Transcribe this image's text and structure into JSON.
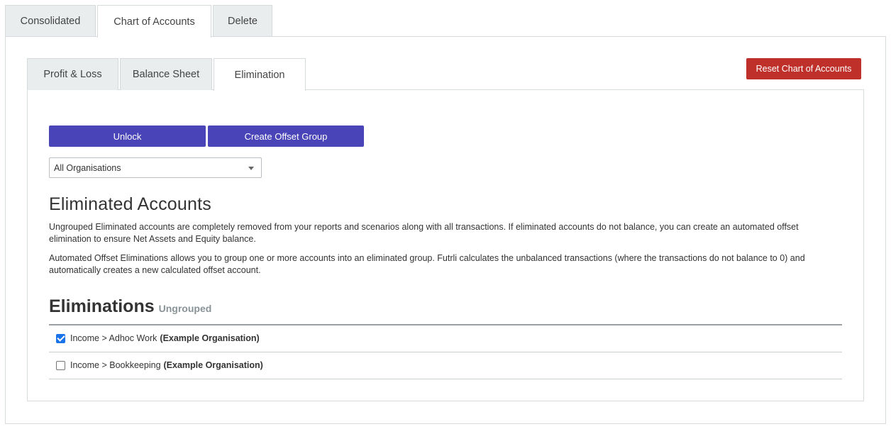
{
  "top_tabs": [
    {
      "label": "Consolidated",
      "active": false
    },
    {
      "label": "Chart of Accounts",
      "active": true
    },
    {
      "label": "Delete",
      "active": false
    }
  ],
  "inner_tabs": [
    {
      "label": "Profit & Loss",
      "active": false
    },
    {
      "label": "Balance Sheet",
      "active": false
    },
    {
      "label": "Elimination",
      "active": true
    }
  ],
  "actions": {
    "reset_label": "Reset Chart of Accounts",
    "unlock_label": "Unlock",
    "create_offset_label": "Create Offset Group"
  },
  "filter": {
    "selected": "All Organisations"
  },
  "eliminated_accounts": {
    "title": "Eliminated Accounts",
    "paragraph1": "Ungrouped Eliminated accounts are completely removed from your reports and scenarios along with all transactions. If eliminated accounts do not balance, you can create an automated offset elimination to ensure Net Assets and Equity balance.",
    "paragraph2": "Automated Offset Eliminations allows you to group one or more accounts into an eliminated group. Futrli calculates the unbalanced transactions (where the transactions do not balance to 0) and automatically creates a new calculated offset account."
  },
  "eliminations": {
    "title": "Eliminations",
    "subtitle": "Ungrouped",
    "rows": [
      {
        "account": "Income > Adhoc Work",
        "org": "(Example Organisation)",
        "checked": true
      },
      {
        "account": "Income > Bookkeeping",
        "org": "(Example Organisation)",
        "checked": false
      }
    ]
  },
  "colors": {
    "primary": "#4a44b9",
    "danger": "#c0302a",
    "checkbox_checked": "#1a73e8"
  }
}
